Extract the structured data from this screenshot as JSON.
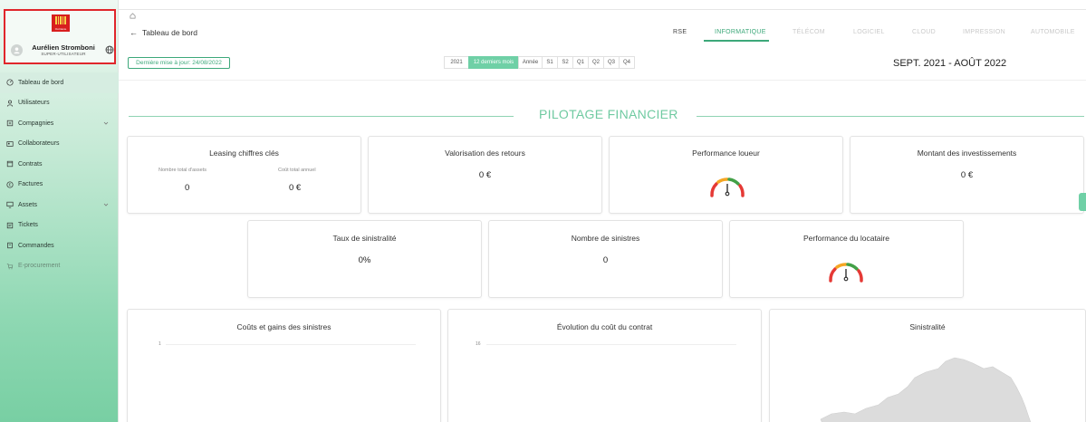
{
  "sidebar": {
    "logo_text": "Occitanie",
    "user_name": "Aurélien Stromboni",
    "user_role": "SUPER-UTILISATEUR",
    "items": [
      {
        "label": "Tableau de bord",
        "icon": "dashboard-icon"
      },
      {
        "label": "Utilisateurs",
        "icon": "user-icon"
      },
      {
        "label": "Compagnies",
        "icon": "building-icon"
      },
      {
        "label": "Collaborateurs",
        "icon": "id-card-icon"
      },
      {
        "label": "Contrats",
        "icon": "contract-icon"
      },
      {
        "label": "Factures",
        "icon": "invoice-icon"
      },
      {
        "label": "Assets",
        "icon": "monitor-icon"
      },
      {
        "label": "Tickets",
        "icon": "ticket-icon"
      },
      {
        "label": "Commandes",
        "icon": "order-icon"
      },
      {
        "label": "E-procurement",
        "icon": "cart-icon"
      }
    ]
  },
  "header": {
    "title": "Tableau de bord",
    "tabs": [
      "RSE",
      "INFORMATIQUE",
      "TÉLÉCOM",
      "LOGICIEL",
      "CLOUD",
      "IMPRESSION",
      "AUTOMOBILE"
    ],
    "active_tab": "INFORMATIQUE",
    "last_update": "Dernière mise à jour: 24/08/2022",
    "periods": [
      "2021",
      "12 derniers mois",
      "Année",
      "S1",
      "S2",
      "Q1",
      "Q2",
      "Q3",
      "Q4"
    ],
    "active_period": "12 derniers mois",
    "date_range": "SEPT. 2021 - AOÛT 2022"
  },
  "section": {
    "title": "PILOTAGE FINANCIER"
  },
  "cards": {
    "leasing": {
      "title": "Leasing chiffres clés",
      "assets_label": "Nombre total d'assets",
      "assets_value": "0",
      "cost_label": "Coût total annuel",
      "cost_value": "0 €"
    },
    "retours": {
      "title": "Valorisation des retours",
      "value": "0 €"
    },
    "loueur": {
      "title": "Performance loueur"
    },
    "investissements": {
      "title": "Montant des investissements",
      "value": "0 €"
    },
    "sinistralite_taux": {
      "title": "Taux de sinistralité",
      "value": "0%"
    },
    "sinistres_nombre": {
      "title": "Nombre de sinistres",
      "value": "0"
    },
    "locataire": {
      "title": "Performance du locataire"
    },
    "couts": {
      "title": "Coûts et gains des sinistres",
      "tick": "1"
    },
    "evolution": {
      "title": "Évolution du coût du contrat",
      "tick": "16"
    },
    "sinistralite_map": {
      "title": "Sinistralité"
    }
  },
  "colors": {
    "accent": "#3da87a",
    "accent_light": "#6fd0a6",
    "highlight_border": "#e0262b",
    "gauge_red": "#e53935",
    "gauge_orange": "#f5a623",
    "gauge_green": "#43a047"
  }
}
